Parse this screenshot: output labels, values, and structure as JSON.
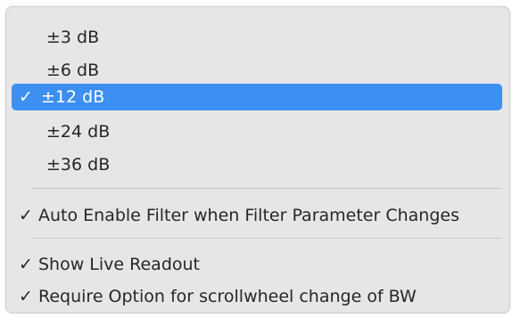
{
  "menu": {
    "check_glyph": "✓",
    "gain_range_items": [
      {
        "label": "±3 dB",
        "checked": false
      },
      {
        "label": "±6 dB",
        "checked": false
      },
      {
        "label": "±12 dB",
        "checked": true,
        "highlighted": true
      },
      {
        "label": "±24 dB",
        "checked": false
      },
      {
        "label": "±36 dB",
        "checked": false
      }
    ],
    "auto_enable": {
      "label": "Auto Enable Filter when Filter Parameter Changes",
      "checked": true
    },
    "show_readout": {
      "label": "Show Live Readout",
      "checked": true
    },
    "require_option": {
      "label": "Require Option for scrollwheel change of BW",
      "checked": true
    }
  },
  "colors": {
    "highlight": "#3d8ff2",
    "menu_bg": "#e6e6e6",
    "text": "#262626",
    "separator": "#c9c9c9"
  }
}
